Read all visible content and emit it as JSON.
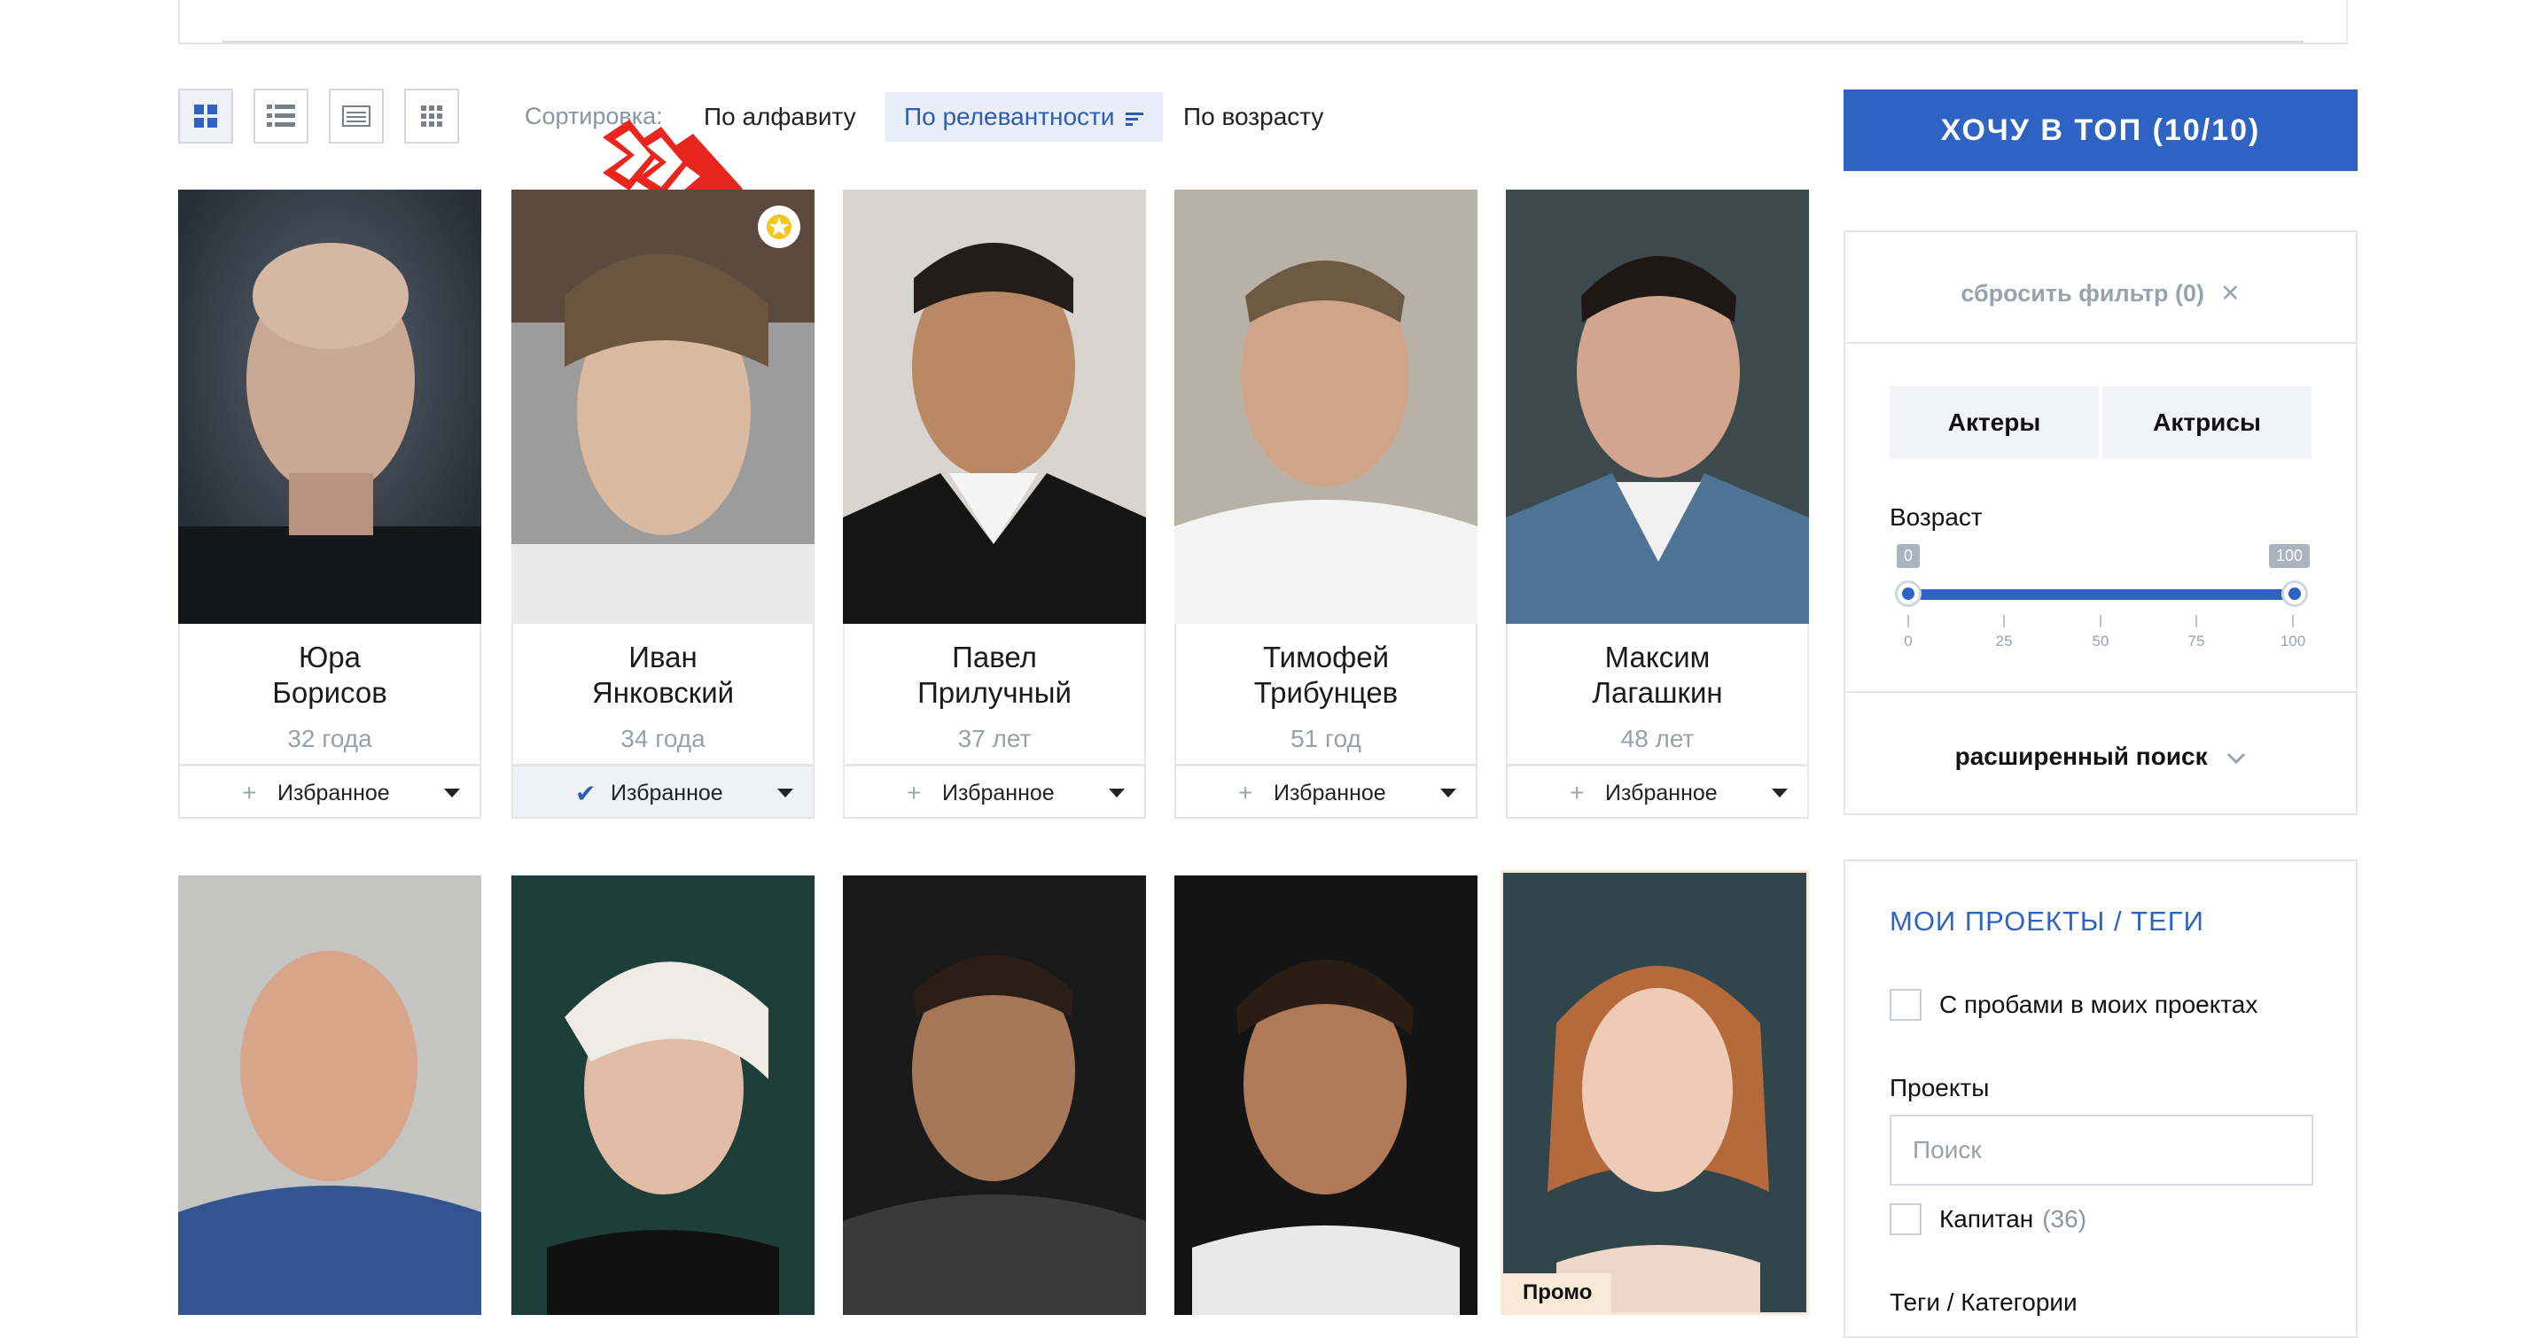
{
  "toolbar": {
    "sort_label": "Сортировка:",
    "sort_options": [
      {
        "label": "По алфавиту",
        "active": false
      },
      {
        "label": "По релевантности",
        "active": true
      },
      {
        "label": "По возрасту",
        "active": false
      }
    ],
    "view_modes": [
      "grid-large-icon",
      "list-icon",
      "table-icon",
      "grid-small-icon"
    ]
  },
  "cta": {
    "label": "ХОЧУ В ТОП (10/10)"
  },
  "filters": {
    "reset_label": "сбросить фильтр (0)",
    "gender": [
      "Актеры",
      "Актрисы"
    ],
    "age_label": "Возраст",
    "age_range": {
      "min": 0,
      "max": 100,
      "selected_min": 0,
      "selected_max": 100,
      "min_label": "0",
      "max_label": "100"
    },
    "age_ticks": [
      "0",
      "25",
      "50",
      "75",
      "100"
    ],
    "advanced_label": "расширенный поиск"
  },
  "projects": {
    "title": "МОИ ПРОЕКТЫ / ТЕГИ",
    "checkbox_label": "С пробами в моих проектах",
    "projects_label": "Проекты",
    "search_placeholder": "Поиск",
    "items": [
      {
        "name": "Капитан",
        "count": "(36)"
      }
    ],
    "tags_label": "Теги / Категории"
  },
  "cards": [
    {
      "first": "Юра",
      "last": "Борисов",
      "age": "32 года",
      "fav_label": "Избранное",
      "in_favorites": false,
      "starred": false
    },
    {
      "first": "Иван",
      "last": "Янковский",
      "age": "34 года",
      "fav_label": "Избранное",
      "in_favorites": true,
      "starred": true
    },
    {
      "first": "Павел",
      "last": "Прилучный",
      "age": "37 лет",
      "fav_label": "Избранное",
      "in_favorites": false,
      "starred": false
    },
    {
      "first": "Тимофей",
      "last": "Трибунцев",
      "age": "51 год",
      "fav_label": "Избранное",
      "in_favorites": false,
      "starred": false
    },
    {
      "first": "Максим",
      "last": "Лагашкин",
      "age": "48 лет",
      "fav_label": "Избранное",
      "in_favorites": false,
      "starred": false
    }
  ],
  "row2": [
    {
      "promo": ""
    },
    {
      "promo": ""
    },
    {
      "promo": ""
    },
    {
      "promo": ""
    },
    {
      "promo": "Промо"
    }
  ],
  "colors": {
    "accent": "#2e63c4",
    "promo_bg": "#f9ead8",
    "marker": "#e8261f"
  }
}
